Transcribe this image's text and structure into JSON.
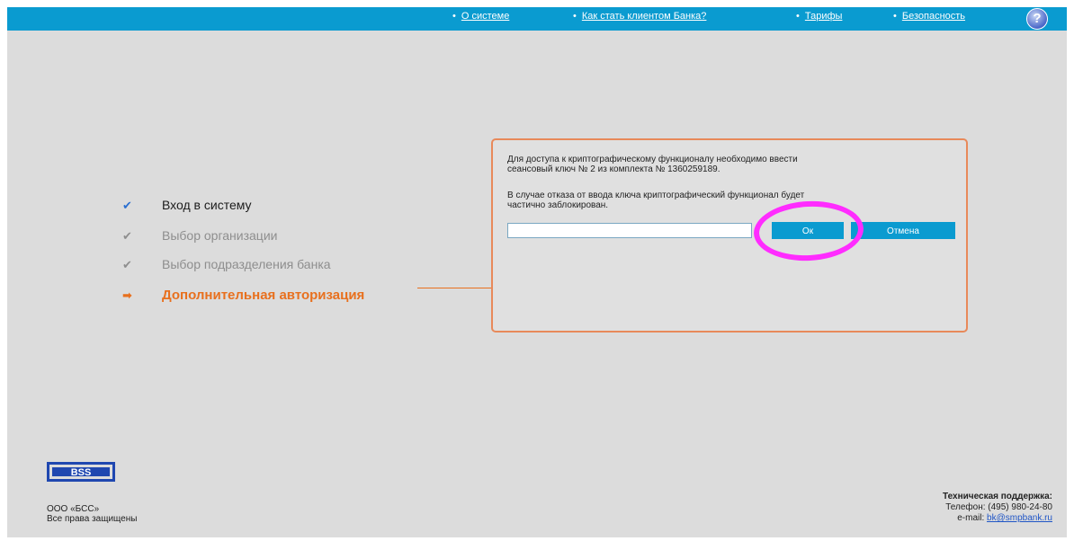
{
  "nav": {
    "links": [
      {
        "label": "О системе"
      },
      {
        "label": "Как стать клиентом Банка?"
      },
      {
        "label": "Тарифы"
      },
      {
        "label": "Безопасность"
      }
    ],
    "help_label": "?"
  },
  "steps": [
    {
      "label": "Вход в систему",
      "mark": "✔",
      "state": "done"
    },
    {
      "label": "Выбор организации",
      "mark": "✔",
      "state": "pending"
    },
    {
      "label": "Выбор подразделения банка",
      "mark": "✔",
      "state": "pending"
    },
    {
      "label": "Дополнительная авторизация",
      "mark": "➡",
      "state": "active"
    }
  ],
  "dialog": {
    "line1": "Для доступа к криптографическому функционалу необходимо ввести",
    "line2": "сеансовый ключ № 2 из комплекта № 1360259189.",
    "line3": "В случае отказа от ввода ключа криптографический функционал будет",
    "line4": "частично заблокирован.",
    "input_value": "",
    "ok_label": "Ок",
    "cancel_label": "Отмена"
  },
  "footer": {
    "logo_text": "BSS",
    "company": "ООО «БСС»",
    "rights": "Все права защищены",
    "support_title": "Техническая поддержка:",
    "phone": "Телефон: (495) 980-24-80",
    "email_label": "e-mail:",
    "email": "bk@smpbank.ru"
  },
  "colors": {
    "topbar": "#0a9bd0",
    "accent": "#e8701e",
    "highlight": "#ff2cff"
  }
}
